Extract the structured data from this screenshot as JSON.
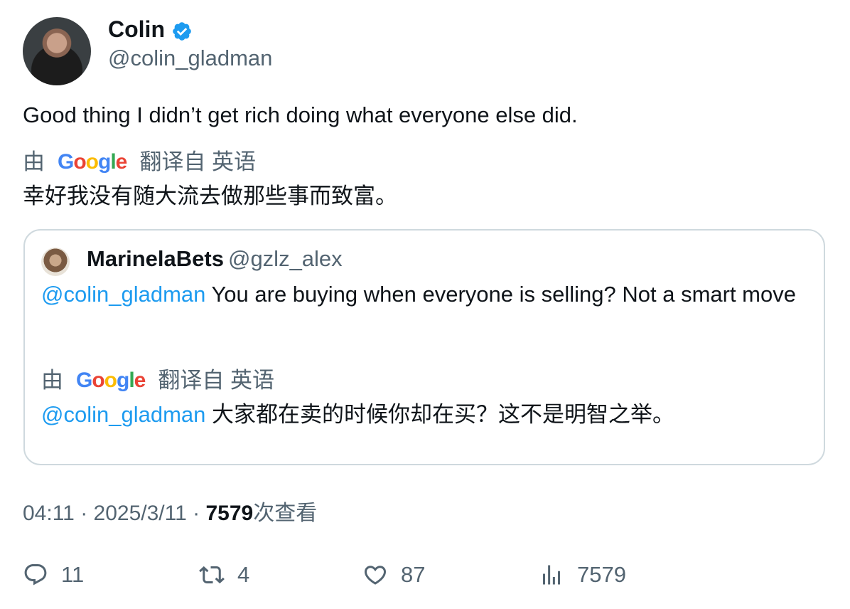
{
  "author": {
    "name": "Colin",
    "handle": "@colin_gladman",
    "verified_color": "#1d9bf0"
  },
  "tweet": {
    "text": "Good thing I didn’t get rich doing what everyone else did.",
    "translation_prefix": "由",
    "translation_brand": "Google",
    "translation_suffix": "翻译自 英语",
    "translated_text": "幸好我没有随大流去做那些事而致富。"
  },
  "quote": {
    "name": "MarinelaBets",
    "handle": "@gzlz_alex",
    "mention": "@colin_gladman",
    "text": "You are buying when everyone is selling? Not a smart move",
    "translation_prefix": "由",
    "translation_brand": "Google",
    "translation_suffix": "翻译自 英语",
    "translated_mention": "@colin_gladman",
    "translated_text": "大家都在卖的时候你却在买？这不是明智之举。"
  },
  "meta": {
    "time": "04:11",
    "sep1": "·",
    "date": "2025/3/11",
    "sep2": "·",
    "views_count": "7579",
    "views_label": "次查看"
  },
  "actions": {
    "replies": "11",
    "retweets": "4",
    "likes": "87",
    "views": "7579"
  }
}
